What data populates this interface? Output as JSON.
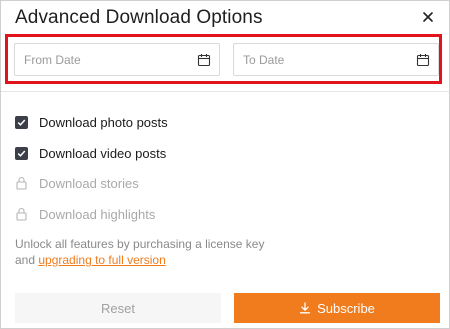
{
  "dialog": {
    "title": "Advanced Download Options",
    "close_icon": "close-icon"
  },
  "date_range": {
    "from": {
      "placeholder": "From Date",
      "value": "",
      "icon": "calendar-icon"
    },
    "to": {
      "placeholder": "To Date",
      "value": "",
      "icon": "calendar-icon"
    },
    "highlight_color": "#e3131b"
  },
  "options": [
    {
      "label": "Download photo posts",
      "state": "checked",
      "enabled": true
    },
    {
      "label": "Download video posts",
      "state": "checked",
      "enabled": true
    },
    {
      "label": "Download stories",
      "state": "locked",
      "enabled": false
    },
    {
      "label": "Download highlights",
      "state": "locked",
      "enabled": false
    }
  ],
  "unlock": {
    "text": "Unlock all features by purchasing a license key",
    "prefix": "and ",
    "link_label": "upgrading to full version"
  },
  "footer": {
    "reset_label": "Reset",
    "subscribe_label": "Subscribe",
    "subscribe_icon": "download-icon"
  },
  "colors": {
    "accent": "#f07c1e",
    "checkbox": "#3c3f48",
    "disabled_text": "#a9a9a9"
  }
}
